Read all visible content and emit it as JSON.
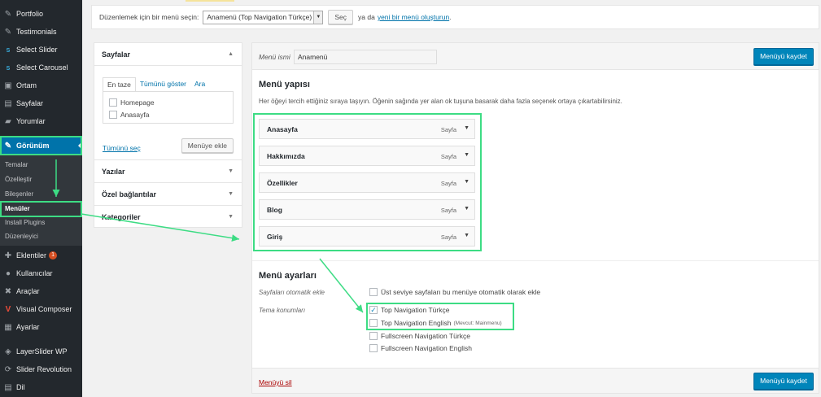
{
  "sidebar": {
    "items": [
      {
        "label": "Portfolio",
        "icon": "pin-icon",
        "glyph": "✎"
      },
      {
        "label": "Testimonials",
        "icon": "pin-icon",
        "glyph": "✎"
      },
      {
        "label": "Select Slider",
        "icon": "s-icon",
        "glyph": "S"
      },
      {
        "label": "Select Carousel",
        "icon": "s-icon",
        "glyph": "S"
      },
      {
        "label": "Ortam",
        "icon": "media-icon",
        "glyph": "▣"
      },
      {
        "label": "Sayfalar",
        "icon": "page-icon",
        "glyph": "▤"
      },
      {
        "label": "Yorumlar",
        "icon": "comment-icon",
        "glyph": "▰"
      },
      {
        "label": "Görünüm",
        "icon": "brush-icon",
        "glyph": "✎"
      },
      {
        "label": "Eklentiler",
        "icon": "plugin-icon",
        "glyph": "✚",
        "badge": "1"
      },
      {
        "label": "Kullanıcılar",
        "icon": "users-icon",
        "glyph": "●"
      },
      {
        "label": "Araçlar",
        "icon": "wrench-icon",
        "glyph": "✖"
      },
      {
        "label": "Visual Composer",
        "icon": "vc-icon",
        "glyph": "V"
      },
      {
        "label": "Ayarlar",
        "icon": "settings-icon",
        "glyph": "▦"
      },
      {
        "label": "LayerSlider WP",
        "icon": "layers-icon",
        "glyph": "◈"
      },
      {
        "label": "Slider Revolution",
        "icon": "refresh-icon",
        "glyph": "⟳"
      },
      {
        "label": "Dil",
        "icon": "language-icon",
        "glyph": "▤"
      }
    ],
    "submenu": [
      "Temalar",
      "Özelleştir",
      "Bileşenler",
      "Menüler",
      "Install Plugins",
      "Düzenleyici"
    ]
  },
  "select_bar": {
    "label": "Düzenlemek için bir menü seçin:",
    "selected": "Anamenü (Top Navigation Türkçe)",
    "button": "Seç",
    "or_text": "ya da",
    "create_link": "yeni bir menü oluşturun",
    "suffix": "."
  },
  "accordion": {
    "pages": {
      "title": "Sayfalar",
      "tabs": [
        "En taze",
        "Tümünü göster",
        "Ara"
      ],
      "items": [
        "Homepage",
        "Anasayfa"
      ],
      "select_all": "Tümünü seç",
      "add_button": "Menüye ekle"
    },
    "sections": [
      "Yazılar",
      "Özel bağlantılar",
      "Kategoriler"
    ]
  },
  "menu": {
    "name_label": "Menü ismi",
    "name_value": "Anamenü",
    "save_button": "Menüyü kaydet",
    "structure_title": "Menü yapısı",
    "structure_desc": "Her öğeyi tercih ettiğiniz sıraya taşıyın. Öğenin sağında yer alan ok tuşuna basarak daha fazla seçenek ortaya çıkartabilirsiniz.",
    "items": [
      {
        "title": "Anasayfa",
        "type": "Sayfa"
      },
      {
        "title": "Hakkımızda",
        "type": "Sayfa"
      },
      {
        "title": "Özellikler",
        "type": "Sayfa"
      },
      {
        "title": "Blog",
        "type": "Sayfa"
      },
      {
        "title": "Giriş",
        "type": "Sayfa"
      }
    ],
    "settings_title": "Menü ayarları",
    "auto_add_label": "Sayfaları otomatik ekle",
    "auto_add_option": "Üst seviye sayfaları bu menüye otomatik olarak ekle",
    "locations_label": "Tema konumları",
    "locations": [
      {
        "label": "Top Navigation Türkçe",
        "checked": true,
        "note": ""
      },
      {
        "label": "Top Navigation English",
        "checked": false,
        "note": "(Mevcut: Mainmenu)"
      },
      {
        "label": "Fullscreen Navigation Türkçe",
        "checked": false,
        "note": ""
      },
      {
        "label": "Fullscreen Navigation English",
        "checked": false,
        "note": ""
      }
    ],
    "delete_link": "Menüyü sil"
  }
}
